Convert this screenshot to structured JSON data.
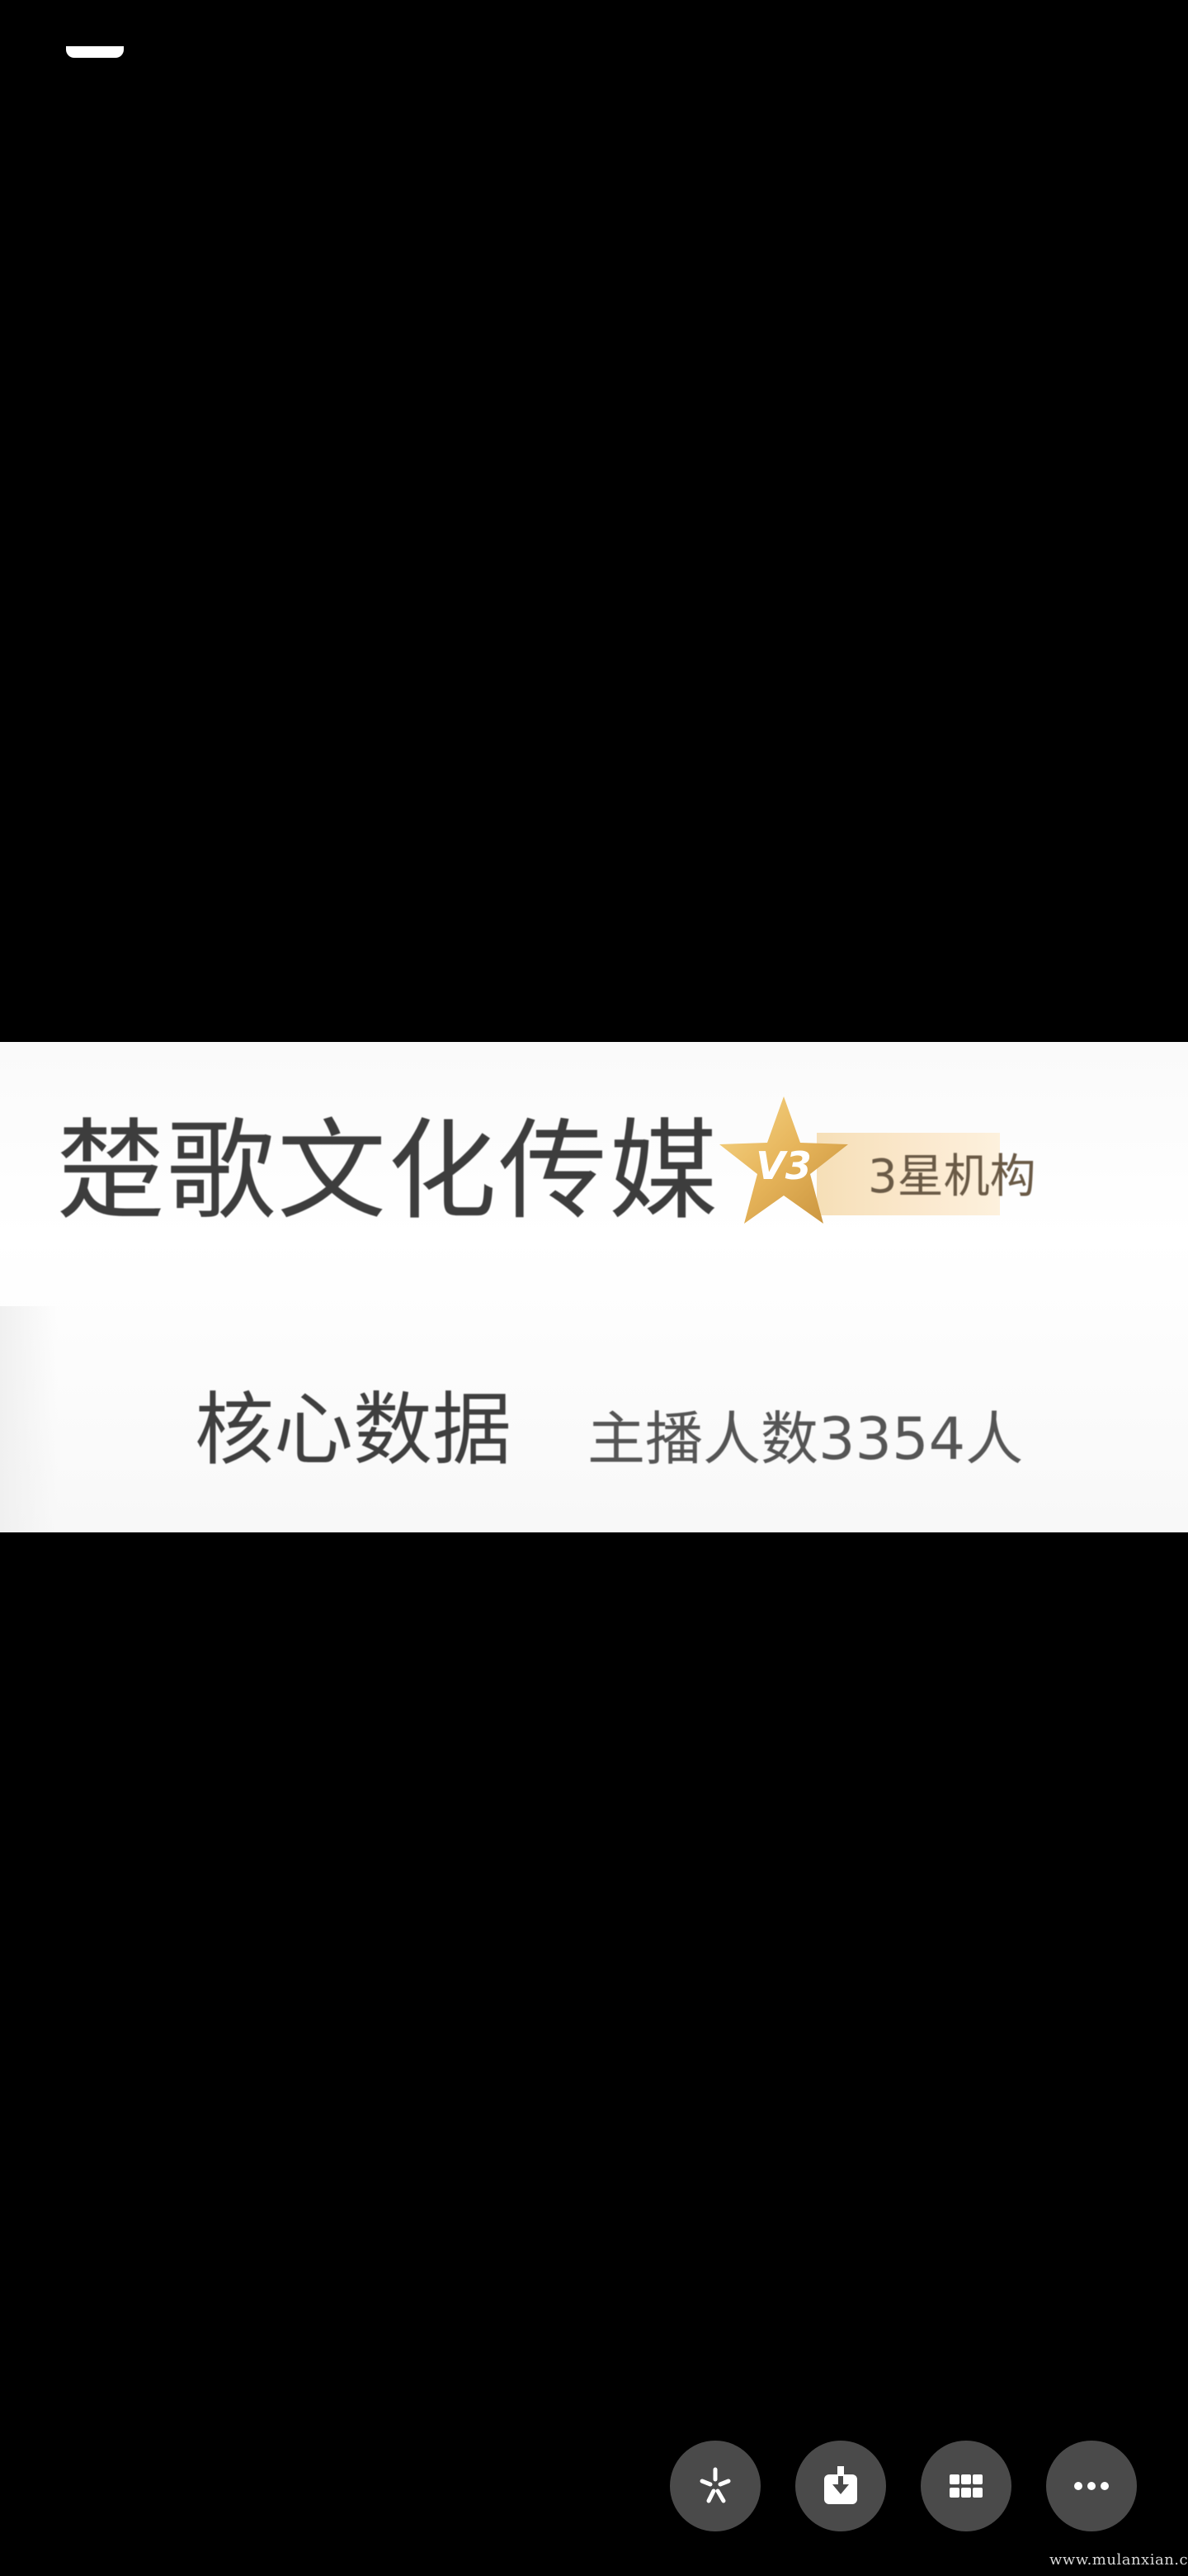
{
  "photo": {
    "org_name": "楚歌文化传媒",
    "badge": {
      "level_glyph": "V3",
      "label": "3星机构"
    },
    "core_label": "核心数据",
    "core_value": "主播人数3354人"
  },
  "toolbar": {
    "buttons": [
      {
        "icon": "sparkle-icon"
      },
      {
        "icon": "download-icon"
      },
      {
        "icon": "grid-icon"
      },
      {
        "icon": "more-icon"
      }
    ]
  },
  "watermark": "www.mulanxian.cn",
  "colors": {
    "background": "#000000",
    "button": "#4a4a4a",
    "badge_gold": "#e6b45a",
    "badge_bar": "#f6dfb7"
  }
}
